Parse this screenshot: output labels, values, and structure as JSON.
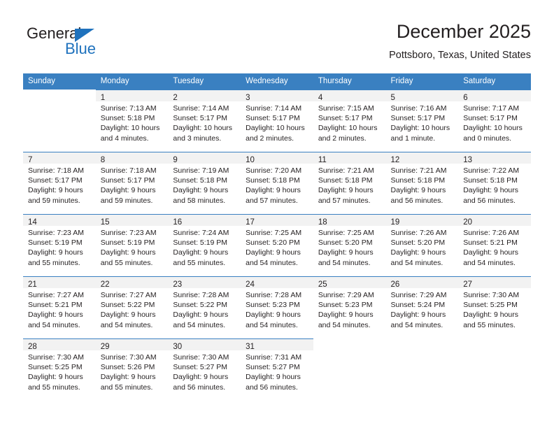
{
  "brand": {
    "name_part1": "General",
    "name_part2": "Blue",
    "triangle_icon": "triangle-icon",
    "accent_color": "#1f72bd"
  },
  "header": {
    "month_title": "December 2025",
    "location": "Pottsboro, Texas, United States"
  },
  "theme": {
    "header_bar": "#3a80c1",
    "daynum_band": "#f2f2f2",
    "text": "#231f20"
  },
  "calendar": {
    "weekday_headers": [
      "Sunday",
      "Monday",
      "Tuesday",
      "Wednesday",
      "Thursday",
      "Friday",
      "Saturday"
    ],
    "weeks": [
      [
        {
          "day": "",
          "lines": [],
          "empty": true
        },
        {
          "day": "1",
          "lines": [
            "Sunrise: 7:13 AM",
            "Sunset: 5:18 PM",
            "Daylight: 10 hours",
            "and 4 minutes."
          ]
        },
        {
          "day": "2",
          "lines": [
            "Sunrise: 7:14 AM",
            "Sunset: 5:17 PM",
            "Daylight: 10 hours",
            "and 3 minutes."
          ]
        },
        {
          "day": "3",
          "lines": [
            "Sunrise: 7:14 AM",
            "Sunset: 5:17 PM",
            "Daylight: 10 hours",
            "and 2 minutes."
          ]
        },
        {
          "day": "4",
          "lines": [
            "Sunrise: 7:15 AM",
            "Sunset: 5:17 PM",
            "Daylight: 10 hours",
            "and 2 minutes."
          ]
        },
        {
          "day": "5",
          "lines": [
            "Sunrise: 7:16 AM",
            "Sunset: 5:17 PM",
            "Daylight: 10 hours",
            "and 1 minute."
          ]
        },
        {
          "day": "6",
          "lines": [
            "Sunrise: 7:17 AM",
            "Sunset: 5:17 PM",
            "Daylight: 10 hours",
            "and 0 minutes."
          ]
        }
      ],
      [
        {
          "day": "7",
          "lines": [
            "Sunrise: 7:18 AM",
            "Sunset: 5:17 PM",
            "Daylight: 9 hours",
            "and 59 minutes."
          ]
        },
        {
          "day": "8",
          "lines": [
            "Sunrise: 7:18 AM",
            "Sunset: 5:17 PM",
            "Daylight: 9 hours",
            "and 59 minutes."
          ]
        },
        {
          "day": "9",
          "lines": [
            "Sunrise: 7:19 AM",
            "Sunset: 5:18 PM",
            "Daylight: 9 hours",
            "and 58 minutes."
          ]
        },
        {
          "day": "10",
          "lines": [
            "Sunrise: 7:20 AM",
            "Sunset: 5:18 PM",
            "Daylight: 9 hours",
            "and 57 minutes."
          ]
        },
        {
          "day": "11",
          "lines": [
            "Sunrise: 7:21 AM",
            "Sunset: 5:18 PM",
            "Daylight: 9 hours",
            "and 57 minutes."
          ]
        },
        {
          "day": "12",
          "lines": [
            "Sunrise: 7:21 AM",
            "Sunset: 5:18 PM",
            "Daylight: 9 hours",
            "and 56 minutes."
          ]
        },
        {
          "day": "13",
          "lines": [
            "Sunrise: 7:22 AM",
            "Sunset: 5:18 PM",
            "Daylight: 9 hours",
            "and 56 minutes."
          ]
        }
      ],
      [
        {
          "day": "14",
          "lines": [
            "Sunrise: 7:23 AM",
            "Sunset: 5:19 PM",
            "Daylight: 9 hours",
            "and 55 minutes."
          ]
        },
        {
          "day": "15",
          "lines": [
            "Sunrise: 7:23 AM",
            "Sunset: 5:19 PM",
            "Daylight: 9 hours",
            "and 55 minutes."
          ]
        },
        {
          "day": "16",
          "lines": [
            "Sunrise: 7:24 AM",
            "Sunset: 5:19 PM",
            "Daylight: 9 hours",
            "and 55 minutes."
          ]
        },
        {
          "day": "17",
          "lines": [
            "Sunrise: 7:25 AM",
            "Sunset: 5:20 PM",
            "Daylight: 9 hours",
            "and 54 minutes."
          ]
        },
        {
          "day": "18",
          "lines": [
            "Sunrise: 7:25 AM",
            "Sunset: 5:20 PM",
            "Daylight: 9 hours",
            "and 54 minutes."
          ]
        },
        {
          "day": "19",
          "lines": [
            "Sunrise: 7:26 AM",
            "Sunset: 5:20 PM",
            "Daylight: 9 hours",
            "and 54 minutes."
          ]
        },
        {
          "day": "20",
          "lines": [
            "Sunrise: 7:26 AM",
            "Sunset: 5:21 PM",
            "Daylight: 9 hours",
            "and 54 minutes."
          ]
        }
      ],
      [
        {
          "day": "21",
          "lines": [
            "Sunrise: 7:27 AM",
            "Sunset: 5:21 PM",
            "Daylight: 9 hours",
            "and 54 minutes."
          ]
        },
        {
          "day": "22",
          "lines": [
            "Sunrise: 7:27 AM",
            "Sunset: 5:22 PM",
            "Daylight: 9 hours",
            "and 54 minutes."
          ]
        },
        {
          "day": "23",
          "lines": [
            "Sunrise: 7:28 AM",
            "Sunset: 5:22 PM",
            "Daylight: 9 hours",
            "and 54 minutes."
          ]
        },
        {
          "day": "24",
          "lines": [
            "Sunrise: 7:28 AM",
            "Sunset: 5:23 PM",
            "Daylight: 9 hours",
            "and 54 minutes."
          ]
        },
        {
          "day": "25",
          "lines": [
            "Sunrise: 7:29 AM",
            "Sunset: 5:23 PM",
            "Daylight: 9 hours",
            "and 54 minutes."
          ]
        },
        {
          "day": "26",
          "lines": [
            "Sunrise: 7:29 AM",
            "Sunset: 5:24 PM",
            "Daylight: 9 hours",
            "and 54 minutes."
          ]
        },
        {
          "day": "27",
          "lines": [
            "Sunrise: 7:30 AM",
            "Sunset: 5:25 PM",
            "Daylight: 9 hours",
            "and 55 minutes."
          ]
        }
      ],
      [
        {
          "day": "28",
          "lines": [
            "Sunrise: 7:30 AM",
            "Sunset: 5:25 PM",
            "Daylight: 9 hours",
            "and 55 minutes."
          ]
        },
        {
          "day": "29",
          "lines": [
            "Sunrise: 7:30 AM",
            "Sunset: 5:26 PM",
            "Daylight: 9 hours",
            "and 55 minutes."
          ]
        },
        {
          "day": "30",
          "lines": [
            "Sunrise: 7:30 AM",
            "Sunset: 5:27 PM",
            "Daylight: 9 hours",
            "and 56 minutes."
          ]
        },
        {
          "day": "31",
          "lines": [
            "Sunrise: 7:31 AM",
            "Sunset: 5:27 PM",
            "Daylight: 9 hours",
            "and 56 minutes."
          ]
        },
        {
          "day": "",
          "lines": [],
          "empty": true
        },
        {
          "day": "",
          "lines": [],
          "empty": true
        },
        {
          "day": "",
          "lines": [],
          "empty": true
        }
      ]
    ]
  }
}
